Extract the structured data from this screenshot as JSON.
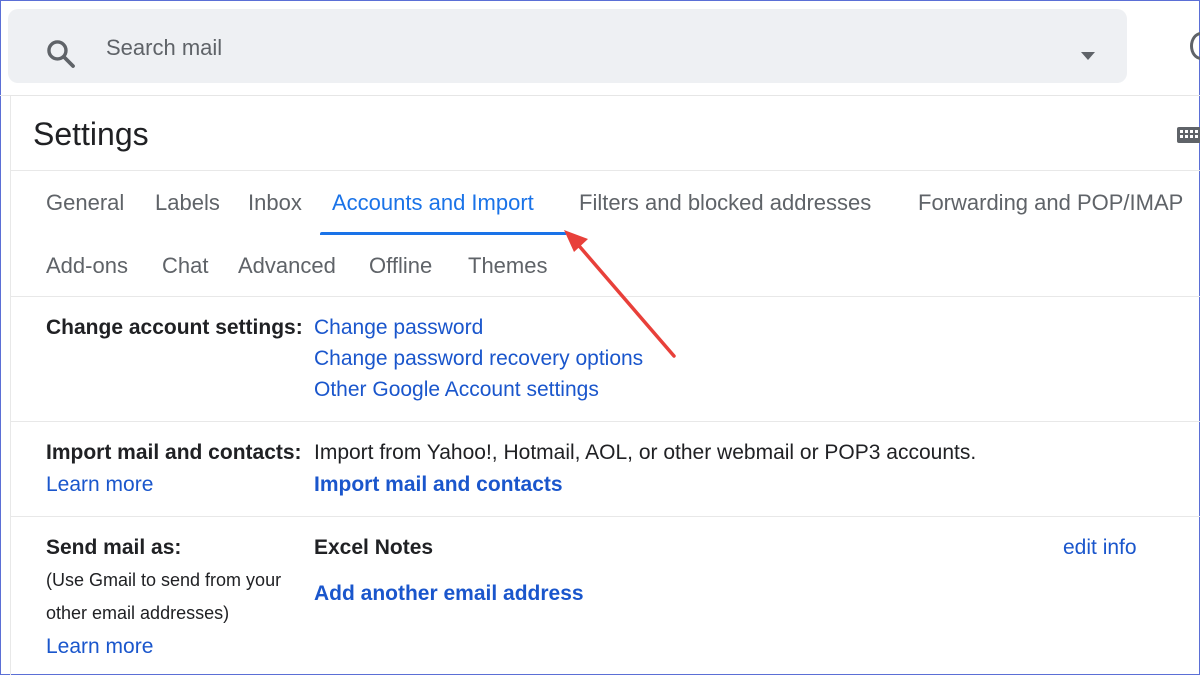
{
  "search": {
    "placeholder": "Search mail",
    "icon": "search-icon",
    "options_icon": "dropdown-arrow-icon"
  },
  "settings": {
    "title": "Settings",
    "tabs_row1": [
      "General",
      "Labels",
      "Inbox",
      "Accounts and Import",
      "Filters and blocked addresses",
      "Forwarding and POP/IMAP"
    ],
    "tabs_row2": [
      "Add-ons",
      "Chat",
      "Advanced",
      "Offline",
      "Themes"
    ],
    "active_tab": "Accounts and Import"
  },
  "change_account": {
    "label": "Change account settings:",
    "links": [
      "Change password",
      "Change password recovery options",
      "Other Google Account settings"
    ]
  },
  "import_mail": {
    "label": "Import mail and contacts:",
    "learn_more": "Learn more",
    "description": "Import from Yahoo!, Hotmail, AOL, or other webmail or POP3 accounts.",
    "action": "Import mail and contacts"
  },
  "send_mail_as": {
    "label": "Send mail as:",
    "note_line1": "(Use Gmail to send from your",
    "note_line2": "other email addresses)",
    "learn_more": "Learn more",
    "account_name": "Excel Notes",
    "edit_info": "edit info",
    "add_address": "Add another email address"
  },
  "colors": {
    "accent": "#1a73e8",
    "link": "#1a56cc",
    "annotation_arrow": "#e8403a"
  }
}
